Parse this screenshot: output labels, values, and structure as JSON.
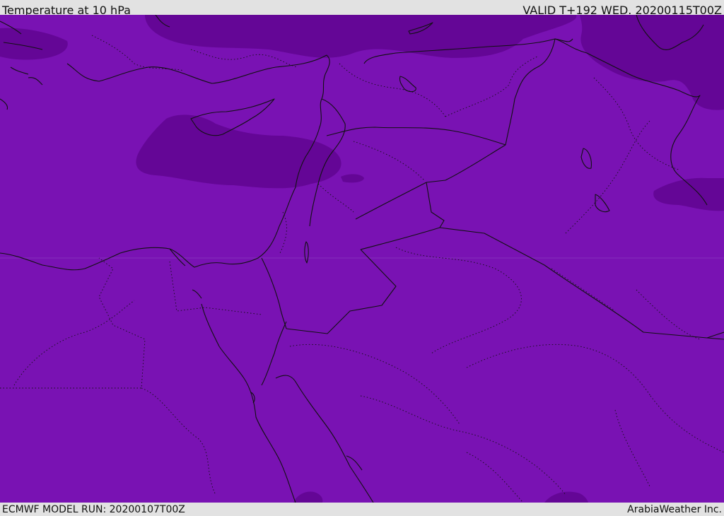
{
  "header": {
    "title": "Temperature at 10 hPa",
    "valid": "VALID T+192 WED. 20200115T00Z"
  },
  "footer": {
    "model_run": "ECMWF MODEL RUN: 20200107T00Z",
    "credit": "ArabiaWeather Inc."
  },
  "map": {
    "fill_color": "#7912b3",
    "cold_color": "#640696",
    "line_color": "#111111",
    "gridline_color": "#8a3bc0"
  }
}
